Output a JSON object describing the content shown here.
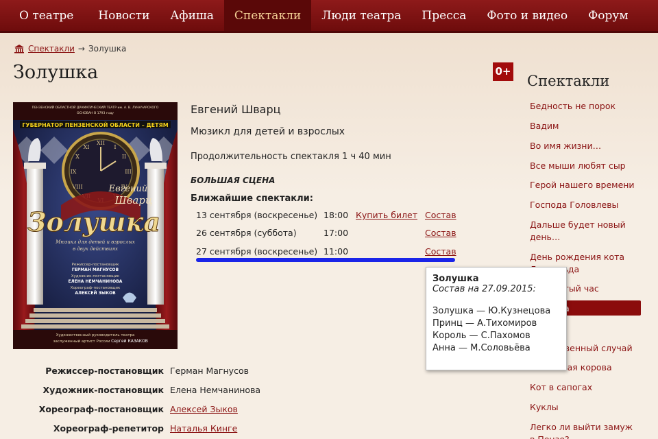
{
  "nav": {
    "items": [
      "О театре",
      "Новости",
      "Афиша",
      "Спектакли",
      "Люди театра",
      "Пресса",
      "Фото и видео",
      "Форум"
    ],
    "active_index": 3
  },
  "breadcrumb": {
    "home_icon": "theatre-home-icon",
    "sep": "→",
    "parent": "Спектакли",
    "current": "Золушка"
  },
  "page": {
    "title": "Золушка",
    "age_rating": "0+"
  },
  "play": {
    "author": "Евгений Шварц",
    "genre": "Мюзикл для детей и взрослых",
    "duration": "Продолжительность спектакля 1 ч 40 мин",
    "stage": "БОЛЬШАЯ СЦЕНА",
    "nearest_label": "Ближайшие спектакли:",
    "performances": [
      {
        "date": "13 сентября (воскресенье)",
        "time": "18:00",
        "buy": "Купить билет",
        "cast": "Состав"
      },
      {
        "date": "26 сентября (суббота)",
        "time": "17:00",
        "buy": "",
        "cast": "Состав"
      },
      {
        "date": "27 сентября (воскресенье)",
        "time": "11:00",
        "buy": "",
        "cast": "Состав"
      }
    ]
  },
  "tooltip": {
    "title": "Золушка",
    "subtitle": "Состав на 27.09.2015:",
    "lines": [
      "Золушка — Ю.Кузнецова",
      "Принц — А.Тихомиров",
      "Король — С.Пахомов",
      "Анна — М.Соловьёва"
    ]
  },
  "poster": {
    "top_text": "ПЕНЗЕНСКИЙ ОБЛАСТНОЙ ДРАМАТИЧЕСКИЙ ТЕАТР им. А. В. ЛУНАЧАРСКОГО",
    "founded": "ОСНОВАН В 1793 году",
    "banner": "ГУБЕРНАТОР ПЕНЗЕНСКОЙ ОБЛАСТИ – ДЕТЯМ",
    "author1": "Евгений",
    "author2": "Шварц",
    "title": "Золушка",
    "subtitle": "Мюзикл для детей и взрослых",
    "subtitle2": "в двух действиях",
    "credits": [
      "Режиссер-постановщик",
      "ГЕРМАН МАГНУСОВ",
      "Художник-постановщик",
      "ЕЛЕНА НЕМЧАНИНОВА",
      "Хореограф-постановщик",
      "АЛЕКСЕЙ ЗЫКОВ"
    ],
    "footer1": "Художественный руководитель театра",
    "footer2": "заслуженный артист России",
    "footer3": "Сергей КАЗАКОВ"
  },
  "credits": [
    {
      "role": "Режиссер-постановщик",
      "name": "Герман Магнусов",
      "link": false
    },
    {
      "role": "Художник-постановщик",
      "name": "Елена Немчанинова",
      "link": false
    },
    {
      "role": "Хореограф-постановщик",
      "name": "Алексей Зыков",
      "link": true
    },
    {
      "role": "Хореограф-репетитор",
      "name": "Наталья Кинге",
      "link": true
    }
  ],
  "sidebar": {
    "title": "Спектакли",
    "items": [
      "Бедность не порок",
      "Вадим",
      "Во имя жизни…",
      "Все мыши любят сыр",
      "Герой нашего времени",
      "Господа Головлевы",
      "Дальше будет новый день…",
      "День рождения кота Леопольда",
      "Двадцатый час",
      "Золушка",
      "Обыкновенный случай",
      "Испанская корова",
      "Кот в сапогах",
      "Куклы",
      "Легко ли выйти замуж в Пензе?"
    ]
  },
  "colors": {
    "brand": "#8a1212",
    "nav_bg": "#7a1010",
    "active_nav_text": "#f3cf95",
    "highlight_line": "#1a24e8"
  }
}
